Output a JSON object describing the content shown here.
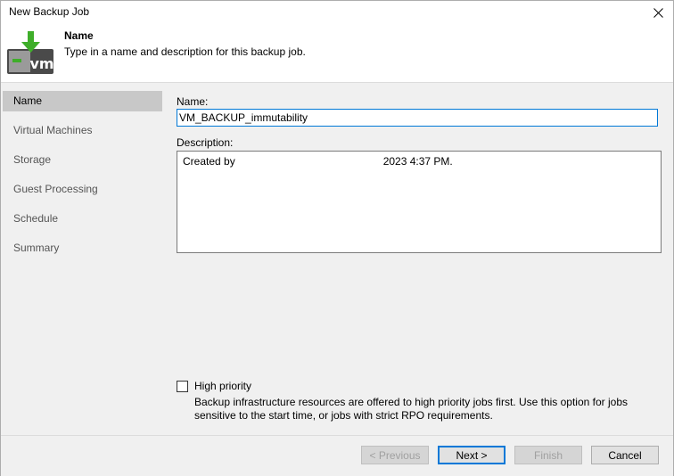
{
  "window": {
    "title": "New Backup Job"
  },
  "header": {
    "title": "Name",
    "subtitle": "Type in a name and description for this backup job."
  },
  "sidebar": {
    "items": [
      {
        "label": "Name",
        "active": true
      },
      {
        "label": "Virtual Machines"
      },
      {
        "label": "Storage"
      },
      {
        "label": "Guest Processing"
      },
      {
        "label": "Schedule"
      },
      {
        "label": "Summary"
      }
    ]
  },
  "form": {
    "name_label": "Name:",
    "name_value": "VM_BACKUP_immutability",
    "description_label": "Description:",
    "description_prefix": "Created by",
    "description_suffix": "2023 4:37 PM.",
    "high_priority_label": "High priority",
    "high_priority_checked": false,
    "high_priority_desc": "Backup infrastructure resources are offered to high priority jobs first. Use this option for jobs sensitive to the start time, or jobs with strict RPO requirements."
  },
  "buttons": {
    "previous": "< Previous",
    "next": "Next >",
    "finish": "Finish",
    "cancel": "Cancel"
  },
  "icons": {
    "logo": "vm-backup-icon",
    "close": "close-icon"
  },
  "colors": {
    "focus_border": "#0078d7",
    "active_nav": "#c8c8c8",
    "logo_green": "#3fae2a",
    "logo_gray": "#4a4a4a"
  }
}
